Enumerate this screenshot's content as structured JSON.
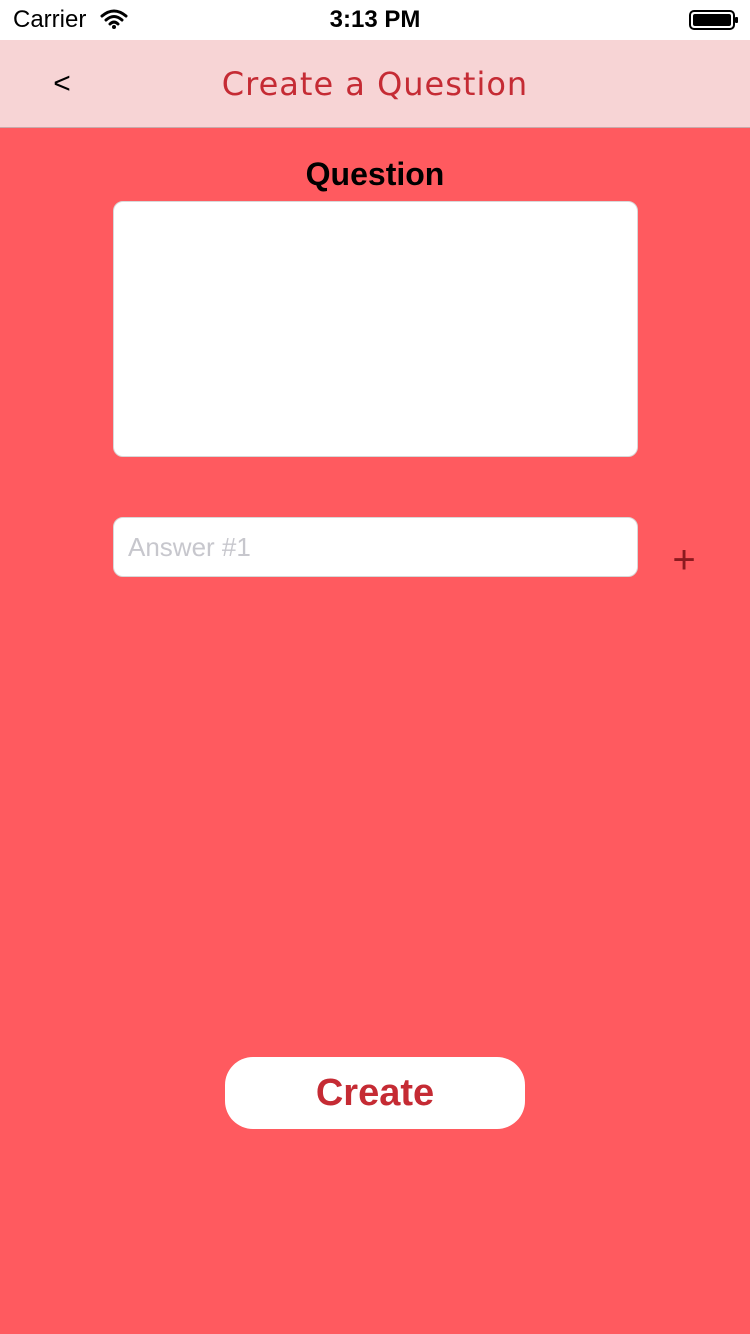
{
  "status_bar": {
    "carrier": "Carrier",
    "time": "3:13 PM",
    "wifi_icon": "wifi-icon",
    "battery_icon": "battery-icon"
  },
  "nav": {
    "back_label": "<",
    "title": "Create a Question",
    "background": "#F7D4D5",
    "title_color": "#C52B34"
  },
  "form": {
    "question_label": "Question",
    "question_value": "",
    "answer_placeholder": "Answer #1",
    "answer_value": "",
    "add_label": "+",
    "add_icon": "plus-icon"
  },
  "actions": {
    "create_label": "Create"
  },
  "colors": {
    "background": "#FF5A5F",
    "accent": "#C52B34"
  }
}
